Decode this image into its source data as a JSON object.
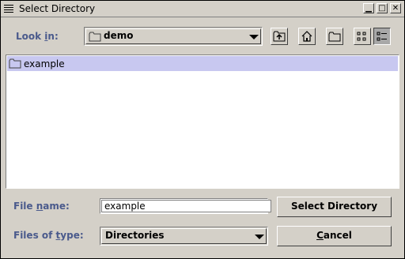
{
  "window": {
    "title": "Select Directory",
    "minimize_glyph": "▁",
    "maximize_glyph": "□",
    "close_glyph": "✕"
  },
  "look_in": {
    "label_prefix": "Look ",
    "label_mnemonic": "i",
    "label_suffix": "n:",
    "value": "demo"
  },
  "toolbar": {
    "buttons": [
      "up-folder",
      "home",
      "new-folder",
      "list-view",
      "details-view"
    ],
    "pressed": "details-view"
  },
  "file_list": {
    "items": [
      {
        "name": "example",
        "icon": "folder-icon",
        "selected": true
      }
    ]
  },
  "file_name": {
    "label_prefix": "File ",
    "label_mnemonic": "n",
    "label_suffix": "ame:",
    "value": "example"
  },
  "files_of_type": {
    "label_prefix": "Files of ",
    "label_mnemonic": "t",
    "label_suffix": "ype:",
    "value": "Directories"
  },
  "buttons": {
    "select_label": "Select Directory",
    "cancel_mnemonic": "C",
    "cancel_rest": "ancel"
  },
  "colors": {
    "label": "#4a5a8c",
    "selection": "#c8c8f0",
    "panel": "#d4d0c8"
  }
}
